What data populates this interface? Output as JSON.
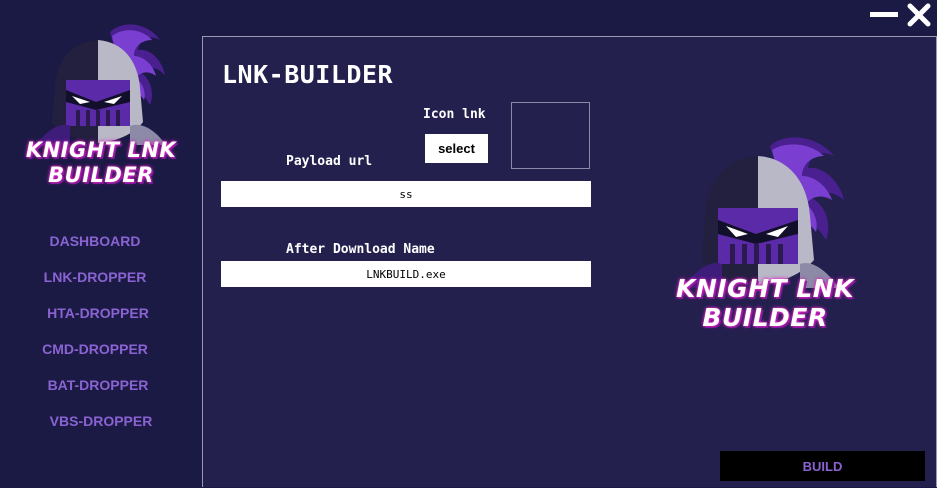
{
  "window": {
    "minimize_icon": "minimize-icon",
    "close_icon": "close-icon"
  },
  "brand": {
    "line1": "KNIGHT LNK",
    "line2": "BUILDER",
    "accent_color": "#8a63d2"
  },
  "sidebar": {
    "items": [
      {
        "label": "DASHBOARD"
      },
      {
        "label": "LNK-DROPPER"
      },
      {
        "label": "HTA-DROPPER"
      },
      {
        "label": "CMD-DROPPER"
      },
      {
        "label": "BAT-DROPPER"
      },
      {
        "label": "VBS-DROPPER"
      }
    ]
  },
  "main": {
    "title": "LNK-BUILDER",
    "icon_label": "Icon lnk",
    "select_label": "select",
    "payload_label": "Payload url",
    "payload_value": "ss",
    "after_download_label": "After Download Name",
    "after_download_value": "LNKBUILD.exe",
    "build_label": "BUILD"
  }
}
